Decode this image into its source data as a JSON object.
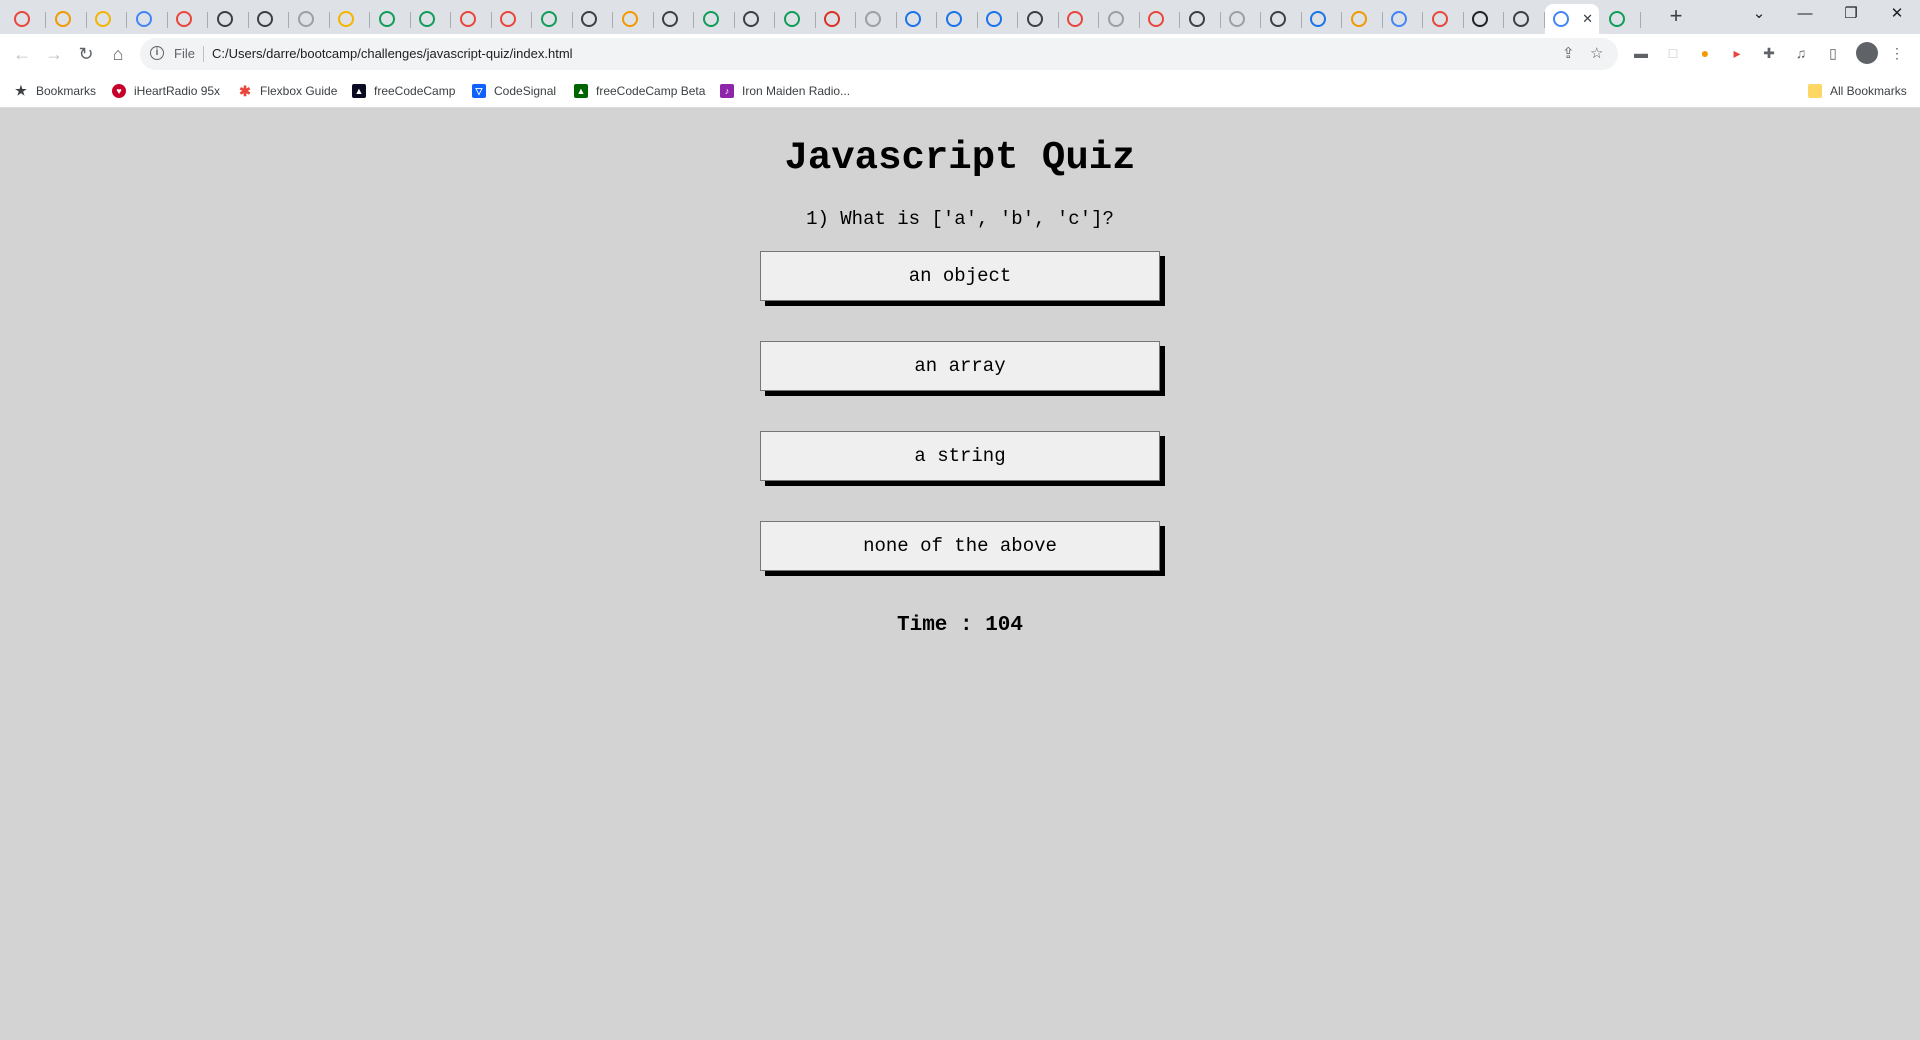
{
  "browser": {
    "tabs": [
      {
        "icon": "heart-icon",
        "color": "#e8453c"
      },
      {
        "icon": "app-icon",
        "color": "#f29900"
      },
      {
        "icon": "smile-icon",
        "color": "#f4b400"
      },
      {
        "icon": "globe-icon",
        "color": "#4285f4"
      },
      {
        "icon": "code-icon",
        "color": "#e8453c"
      },
      {
        "icon": "github-icon",
        "color": "#3c4043"
      },
      {
        "icon": "github-icon",
        "color": "#3c4043"
      },
      {
        "icon": "google-icon",
        "color": "#9aa0a6"
      },
      {
        "icon": "google-icon",
        "color": "#f4b400"
      },
      {
        "icon": "link-icon",
        "color": "#0f9d58"
      },
      {
        "icon": "link-icon",
        "color": "#0f9d58"
      },
      {
        "icon": "google-icon",
        "color": "#e8453c"
      },
      {
        "icon": "google-icon",
        "color": "#e8453c"
      },
      {
        "icon": "w-icon",
        "color": "#0f9d58"
      },
      {
        "icon": "github-icon",
        "color": "#3c4043"
      },
      {
        "icon": "google-icon",
        "color": "#f29900"
      },
      {
        "icon": "circle-icon",
        "color": "#3c4043"
      },
      {
        "icon": "w-icon",
        "color": "#0f9d58"
      },
      {
        "icon": "github-icon",
        "color": "#3c4043"
      },
      {
        "icon": "grid-icon",
        "color": "#0f9d58"
      },
      {
        "icon": "power-icon",
        "color": "#d93025"
      },
      {
        "icon": "google-icon",
        "color": "#9aa0a6"
      },
      {
        "icon": "vimeo-icon",
        "color": "#1a73e8"
      },
      {
        "icon": "vimeo-icon",
        "color": "#1a73e8"
      },
      {
        "icon": "vimeo-icon",
        "color": "#1a73e8"
      },
      {
        "icon": "globe-icon",
        "color": "#3c4043"
      },
      {
        "icon": "google-icon",
        "color": "#e8453c"
      },
      {
        "icon": "google-icon",
        "color": "#9aa0a6"
      },
      {
        "icon": "app-icon",
        "color": "#e8453c"
      },
      {
        "icon": "chrome-icon",
        "color": "#3c4043"
      },
      {
        "icon": "google-icon",
        "color": "#9aa0a6"
      },
      {
        "icon": "github-icon",
        "color": "#3c4043"
      },
      {
        "icon": "api-icon",
        "color": "#1a73e8"
      },
      {
        "icon": "google-icon",
        "color": "#f29900"
      },
      {
        "icon": "cloud-icon",
        "color": "#4285f4"
      },
      {
        "icon": "google-icon",
        "color": "#e8453c"
      },
      {
        "icon": "github-icon",
        "color": "#202124"
      },
      {
        "icon": "github-icon",
        "color": "#3c4043"
      },
      {
        "icon": "google-icon",
        "color": "#4285f4",
        "active": true
      },
      {
        "icon": "w-icon",
        "color": "#0f9d58"
      }
    ],
    "new_tab_label": "+",
    "address_scheme": "File",
    "address_url": "C:/Users/darre/bootcamp/challenges/javascript-quiz/index.html"
  },
  "bookmarks": {
    "items": [
      {
        "label": "Bookmarks",
        "icon": "star-icon",
        "color": "#3c4043"
      },
      {
        "label": "iHeartRadio 95x",
        "icon": "iheart-icon",
        "color": "#c6002b"
      },
      {
        "label": "Flexbox Guide",
        "icon": "asterisk-icon",
        "color": "#e8453c"
      },
      {
        "label": "freeCodeCamp",
        "icon": "fcc-icon",
        "color": "#0a0a23"
      },
      {
        "label": "CodeSignal",
        "icon": "codesignal-icon",
        "color": "#1062fb"
      },
      {
        "label": "freeCodeCamp Beta",
        "icon": "fcc-beta-icon",
        "color": "#006400"
      },
      {
        "label": "Iron Maiden Radio...",
        "icon": "radio-icon",
        "color": "#8e24aa"
      }
    ],
    "all_bookmarks_label": "All Bookmarks"
  },
  "quiz": {
    "title": "Javascript Quiz",
    "question": "1) What is ['a', 'b', 'c']?",
    "choices": [
      "an object",
      "an array",
      "a string",
      "none of the above"
    ],
    "timer_label": "Time : 104"
  }
}
